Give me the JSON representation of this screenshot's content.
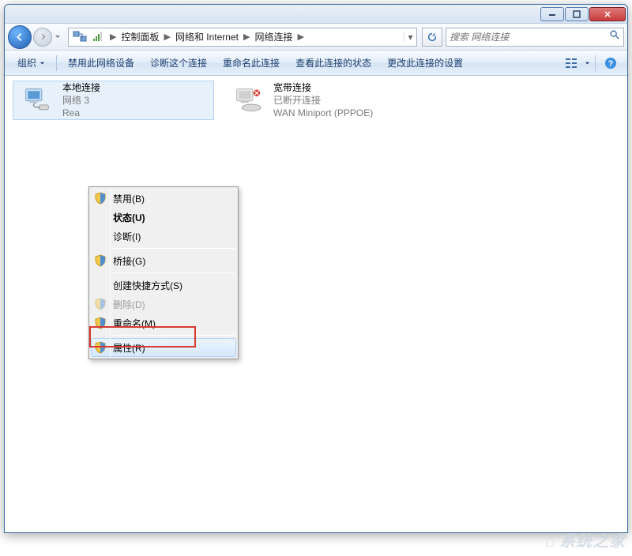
{
  "breadcrumb": {
    "items": [
      "控制面板",
      "网络和 Internet",
      "网络连接"
    ]
  },
  "search": {
    "placeholder": "搜索 网络连接"
  },
  "toolbar": {
    "organize": "组织",
    "disable": "禁用此网络设备",
    "diagnose": "诊断这个连接",
    "rename": "重命名此连接",
    "view_status": "查看此连接的状态",
    "change_settings": "更改此连接的设置"
  },
  "connections": [
    {
      "title": "本地连接",
      "sub1": "网络  3",
      "sub2": "Rea"
    },
    {
      "title": "宽带连接",
      "sub1": "已断开连接",
      "sub2": "WAN Miniport (PPPOE)"
    }
  ],
  "context_menu": {
    "disable": "禁用(B)",
    "status": "状态(U)",
    "diagnose": "诊断(I)",
    "bridge": "桥接(G)",
    "shortcut": "创建快捷方式(S)",
    "delete": "删除(D)",
    "rename": "重命名(M)",
    "properties": "属性(R)"
  },
  "watermark": "系统之家"
}
